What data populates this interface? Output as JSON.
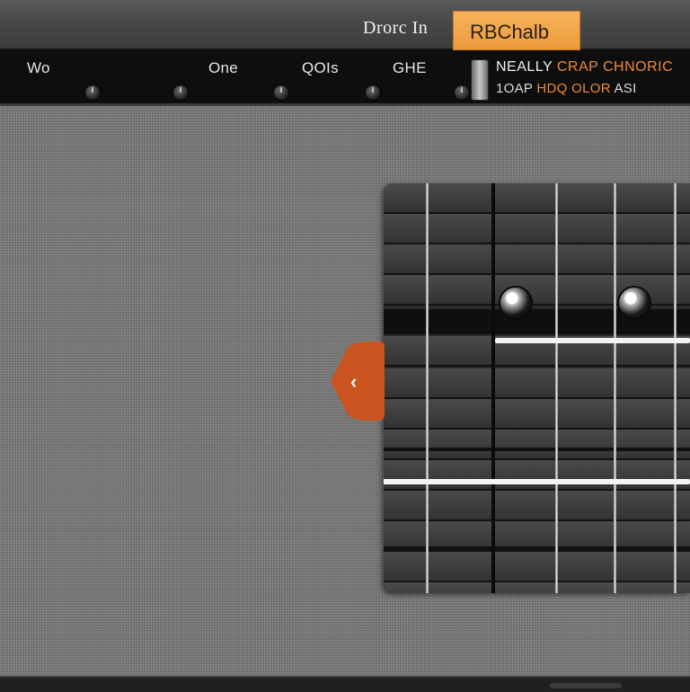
{
  "header": {
    "mode_label": "Drorc In",
    "mode_button": "RBChalb"
  },
  "toolbar": {
    "tabs": [
      "Wo",
      "One",
      "QOIs",
      "GHE"
    ],
    "info_line_1_a": "NEALLY",
    "info_line_1_b": "CRAP",
    "info_line_1_c": "CHNORIC",
    "info_line_2_a": "1OAP",
    "info_line_2_b": "HDQ",
    "info_line_2_c": "OLOR",
    "info_line_2_d": "ASI"
  },
  "panel": {
    "collapse_icon": "chevron-left-icon",
    "collapse_glyph": "‹"
  },
  "colors": {
    "accent": "#ec9a3a",
    "collapse_tab": "#c9541f",
    "fabric": "#7e7c7a"
  }
}
